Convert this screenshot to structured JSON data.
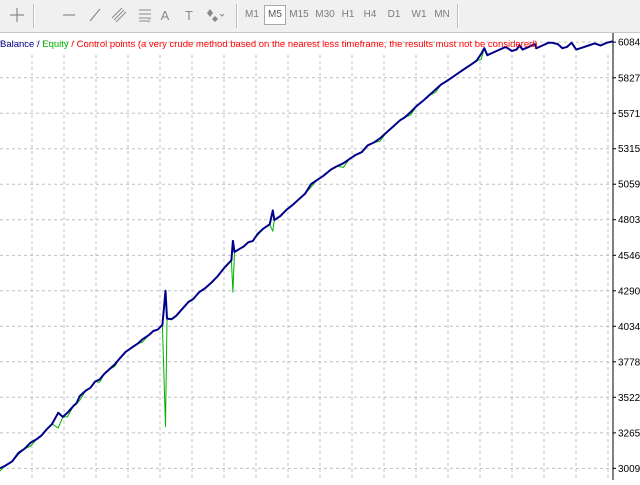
{
  "toolbar": {
    "tools": [
      {
        "icon": "crosshair-icon"
      },
      {
        "icon": "horizontal-line-icon"
      },
      {
        "icon": "trendline-icon"
      },
      {
        "icon": "equidistant-channel-icon"
      },
      {
        "icon": "fibonacci-icon"
      },
      {
        "icon": "text-icon",
        "glyph": "A"
      },
      {
        "icon": "text-label-icon",
        "glyph": "T"
      },
      {
        "icon": "shapes-icon"
      }
    ],
    "timeframes": [
      "M1",
      "M5",
      "M15",
      "M30",
      "H1",
      "H4",
      "D1",
      "W1",
      "MN"
    ],
    "active_timeframe": "M5"
  },
  "legend": {
    "balance": "Balance",
    "sep1": " / ",
    "equity": "Equity",
    "sep2": " / ",
    "control": "Control points (a very crude method based on the nearest less timeframe, the results must not be considered)"
  },
  "colors": {
    "balance": "#00008b",
    "equity": "#00b000",
    "control": "#ff0000",
    "grid": "#c0c0c0",
    "axis_text": "#000000"
  },
  "chart_data": {
    "type": "line",
    "y_ticks": [
      6084,
      5827,
      5571,
      5315,
      5059,
      4803,
      4546,
      4290,
      4034,
      3778,
      3522,
      3265,
      3009
    ],
    "ylim": [
      2925,
      6150
    ],
    "x_steps": [
      0,
      400
    ],
    "grid": true,
    "series": [
      {
        "name": "Balance",
        "color": "#00008b",
        "points": [
          [
            0,
            3010
          ],
          [
            3,
            3025
          ],
          [
            8,
            3060
          ],
          [
            12,
            3120
          ],
          [
            16,
            3150
          ],
          [
            20,
            3195
          ],
          [
            24,
            3220
          ],
          [
            27,
            3245
          ],
          [
            30,
            3285
          ],
          [
            34,
            3330
          ],
          [
            38,
            3410
          ],
          [
            41,
            3380
          ],
          [
            44,
            3410
          ],
          [
            48,
            3460
          ],
          [
            50,
            3480
          ],
          [
            52,
            3530
          ],
          [
            56,
            3570
          ],
          [
            59,
            3590
          ],
          [
            62,
            3635
          ],
          [
            65,
            3650
          ],
          [
            68,
            3690
          ],
          [
            71,
            3720
          ],
          [
            75,
            3760
          ],
          [
            78,
            3800
          ],
          [
            82,
            3850
          ],
          [
            86,
            3880
          ],
          [
            90,
            3910
          ],
          [
            93,
            3940
          ],
          [
            97,
            3970
          ],
          [
            100,
            4000
          ],
          [
            103,
            4010
          ],
          [
            106,
            4045
          ],
          [
            108,
            4290
          ],
          [
            109,
            4090
          ],
          [
            112,
            4085
          ],
          [
            115,
            4110
          ],
          [
            119,
            4160
          ],
          [
            123,
            4210
          ],
          [
            126,
            4230
          ],
          [
            130,
            4280
          ],
          [
            134,
            4310
          ],
          [
            138,
            4350
          ],
          [
            142,
            4395
          ],
          [
            146,
            4450
          ],
          [
            148,
            4475
          ],
          [
            151,
            4510
          ],
          [
            152,
            4650
          ],
          [
            153,
            4570
          ],
          [
            156,
            4590
          ],
          [
            159,
            4610
          ],
          [
            162,
            4640
          ],
          [
            165,
            4650
          ],
          [
            168,
            4700
          ],
          [
            172,
            4740
          ],
          [
            176,
            4770
          ],
          [
            178,
            4870
          ],
          [
            179,
            4800
          ],
          [
            183,
            4830
          ],
          [
            187,
            4875
          ],
          [
            191,
            4910
          ],
          [
            195,
            4950
          ],
          [
            199,
            4990
          ],
          [
            203,
            5060
          ],
          [
            207,
            5090
          ],
          [
            211,
            5120
          ],
          [
            216,
            5165
          ],
          [
            220,
            5190
          ],
          [
            224,
            5210
          ],
          [
            228,
            5240
          ],
          [
            232,
            5270
          ],
          [
            236,
            5290
          ],
          [
            240,
            5340
          ],
          [
            244,
            5360
          ],
          [
            248,
            5390
          ],
          [
            252,
            5430
          ],
          [
            257,
            5480
          ],
          [
            261,
            5520
          ],
          [
            264,
            5540
          ],
          [
            268,
            5580
          ],
          [
            272,
            5625
          ],
          [
            276,
            5660
          ],
          [
            280,
            5700
          ],
          [
            284,
            5740
          ],
          [
            288,
            5780
          ],
          [
            291,
            5800
          ],
          [
            295,
            5830
          ],
          [
            299,
            5860
          ],
          [
            303,
            5890
          ],
          [
            307,
            5920
          ],
          [
            311,
            5950
          ],
          [
            314,
            6000
          ],
          [
            316,
            6040
          ],
          [
            318,
            5990
          ],
          [
            322,
            6010
          ],
          [
            326,
            6030
          ],
          [
            330,
            6050
          ],
          [
            334,
            6020
          ],
          [
            337,
            6030
          ],
          [
            339,
            6060
          ],
          [
            341,
            6030
          ],
          [
            345,
            6050
          ],
          [
            349,
            6070
          ],
          [
            350,
            6040
          ],
          [
            354,
            6060
          ],
          [
            358,
            6080
          ],
          [
            360,
            6080
          ],
          [
            364,
            6070
          ],
          [
            367,
            6040
          ],
          [
            370,
            6050
          ],
          [
            373,
            6080
          ],
          [
            376,
            6030
          ],
          [
            380,
            6045
          ],
          [
            384,
            6060
          ],
          [
            388,
            6075
          ],
          [
            392,
            6060
          ],
          [
            396,
            6080
          ],
          [
            400,
            6090
          ]
        ]
      },
      {
        "name": "Equity",
        "color": "#00b000",
        "points": [
          [
            0,
            2990
          ],
          [
            3,
            3025
          ],
          [
            8,
            3060
          ],
          [
            12,
            3110
          ],
          [
            16,
            3150
          ],
          [
            20,
            3170
          ],
          [
            24,
            3220
          ],
          [
            27,
            3245
          ],
          [
            30,
            3285
          ],
          [
            34,
            3330
          ],
          [
            38,
            3300
          ],
          [
            41,
            3380
          ],
          [
            44,
            3380
          ],
          [
            48,
            3460
          ],
          [
            50,
            3475
          ],
          [
            52,
            3500
          ],
          [
            56,
            3570
          ],
          [
            59,
            3590
          ],
          [
            62,
            3635
          ],
          [
            65,
            3630
          ],
          [
            68,
            3690
          ],
          [
            71,
            3720
          ],
          [
            75,
            3745
          ],
          [
            78,
            3800
          ],
          [
            82,
            3850
          ],
          [
            86,
            3880
          ],
          [
            90,
            3910
          ],
          [
            93,
            3920
          ],
          [
            97,
            3970
          ],
          [
            100,
            4000
          ],
          [
            103,
            4010
          ],
          [
            106,
            4045
          ],
          [
            108,
            3310
          ],
          [
            109,
            4085
          ],
          [
            112,
            4085
          ],
          [
            115,
            4110
          ],
          [
            119,
            4160
          ],
          [
            123,
            4210
          ],
          [
            126,
            4230
          ],
          [
            130,
            4280
          ],
          [
            134,
            4310
          ],
          [
            138,
            4350
          ],
          [
            142,
            4395
          ],
          [
            146,
            4450
          ],
          [
            148,
            4475
          ],
          [
            151,
            4510
          ],
          [
            152,
            4280
          ],
          [
            153,
            4570
          ],
          [
            156,
            4590
          ],
          [
            159,
            4610
          ],
          [
            162,
            4640
          ],
          [
            165,
            4650
          ],
          [
            168,
            4690
          ],
          [
            172,
            4740
          ],
          [
            176,
            4770
          ],
          [
            178,
            4720
          ],
          [
            179,
            4800
          ],
          [
            183,
            4830
          ],
          [
            187,
            4875
          ],
          [
            191,
            4910
          ],
          [
            195,
            4950
          ],
          [
            199,
            4990
          ],
          [
            203,
            5040
          ],
          [
            207,
            5090
          ],
          [
            211,
            5120
          ],
          [
            216,
            5165
          ],
          [
            220,
            5190
          ],
          [
            224,
            5180
          ],
          [
            228,
            5240
          ],
          [
            232,
            5270
          ],
          [
            236,
            5290
          ],
          [
            240,
            5340
          ],
          [
            244,
            5360
          ],
          [
            248,
            5370
          ],
          [
            252,
            5430
          ],
          [
            257,
            5480
          ],
          [
            261,
            5520
          ],
          [
            264,
            5540
          ],
          [
            268,
            5560
          ],
          [
            272,
            5625
          ],
          [
            276,
            5660
          ],
          [
            280,
            5700
          ],
          [
            284,
            5720
          ],
          [
            288,
            5780
          ],
          [
            291,
            5800
          ],
          [
            295,
            5830
          ],
          [
            299,
            5860
          ],
          [
            303,
            5890
          ],
          [
            307,
            5920
          ],
          [
            311,
            5950
          ],
          [
            314,
            5960
          ],
          [
            316,
            6040
          ],
          [
            318,
            5990
          ],
          [
            322,
            6010
          ],
          [
            326,
            6030
          ],
          [
            330,
            6050
          ],
          [
            334,
            6020
          ],
          [
            337,
            6030
          ],
          [
            339,
            6060
          ],
          [
            341,
            6030
          ],
          [
            345,
            6050
          ],
          [
            349,
            6070
          ],
          [
            350,
            6040
          ],
          [
            354,
            6060
          ],
          [
            358,
            6080
          ],
          [
            360,
            6080
          ],
          [
            364,
            6070
          ],
          [
            367,
            6040
          ],
          [
            370,
            6050
          ],
          [
            373,
            6080
          ],
          [
            376,
            6030
          ],
          [
            380,
            6045
          ],
          [
            384,
            6060
          ],
          [
            388,
            6075
          ],
          [
            392,
            6060
          ],
          [
            396,
            6080
          ],
          [
            400,
            6090
          ]
        ]
      }
    ]
  }
}
